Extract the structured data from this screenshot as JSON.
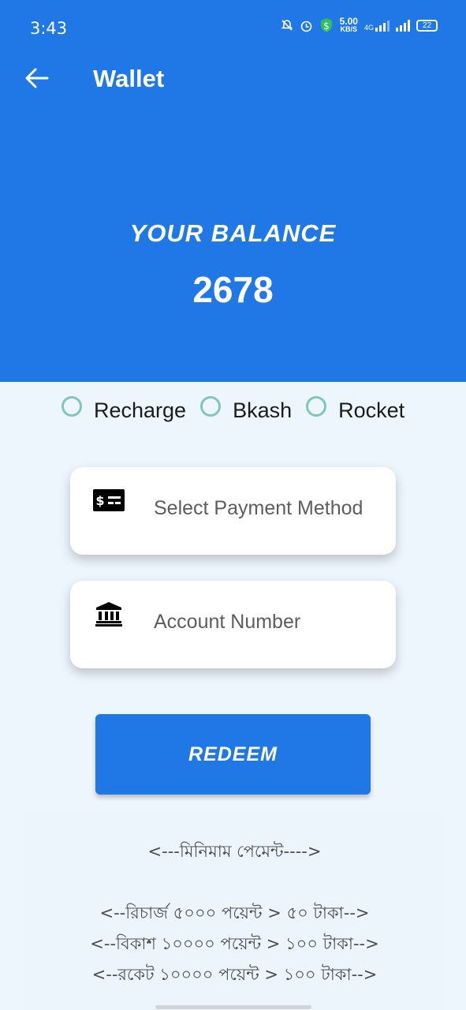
{
  "status_bar": {
    "time": "3:43",
    "net_speed_value": "5.00",
    "net_speed_unit": "KB/S",
    "network_type": "4G",
    "battery": "22"
  },
  "app_bar": {
    "title": "Wallet",
    "back_icon": "arrow-left-icon"
  },
  "balance": {
    "label": "YOUR BALANCE",
    "value": "2678"
  },
  "payment_options": [
    {
      "label": "Recharge",
      "selected": false
    },
    {
      "label": "Bkash",
      "selected": false
    },
    {
      "label": "Rocket",
      "selected": false
    }
  ],
  "form": {
    "payment_method": {
      "placeholder": "Select Payment Method",
      "icon": "money-bill-icon"
    },
    "account_number": {
      "placeholder": "Account Number",
      "icon": "bank-icon"
    }
  },
  "redeem_button": {
    "label": "REDEEM"
  },
  "info": {
    "heading": "<---মিনিমাম পেমেন্ট---->",
    "lines": [
      "<--রিচার্জ ৫০০০ পয়েন্ট > ৫০ টাকা-->",
      "<--বিকাশ ১০০০০ পয়েন্ট > ১০০ টাকা-->",
      "<--রকেট ১০০০০ পয়েন্ট > ১০০ টাকা-->"
    ]
  },
  "colors": {
    "primary": "#1f78e5",
    "background": "#eef6fd",
    "radio_ring": "#7fc6bd"
  }
}
